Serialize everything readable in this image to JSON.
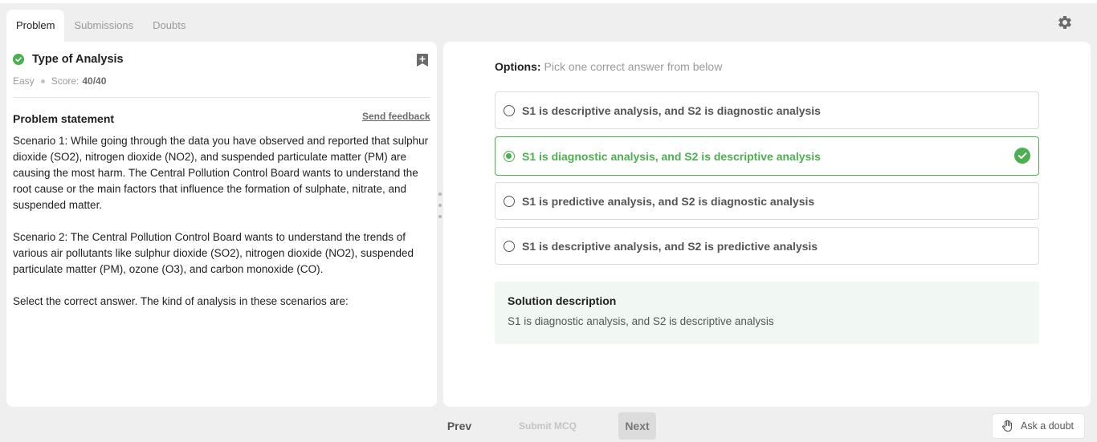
{
  "tabs": [
    {
      "label": "Problem",
      "active": true
    },
    {
      "label": "Submissions",
      "active": false
    },
    {
      "label": "Doubts",
      "active": false
    }
  ],
  "problem": {
    "title": "Type of Analysis",
    "difficulty": "Easy",
    "score_label": "Score:",
    "score_value": "40/40",
    "statement_heading": "Problem statement",
    "feedback_link": "Send feedback",
    "paragraphs": [
      "Scenario 1: While going through the data you have observed and reported that sulphur dioxide (SO2), nitrogen dioxide (NO2), and suspended particulate matter (PM) are causing the most harm. The Central Pollution Control Board wants to understand the root cause or the main factors that influence the formation of sulphate, nitrate, and suspended matter.",
      "Scenario 2: The Central Pollution Control Board wants to understand the trends of various air pollutants like sulphur dioxide (SO2), nitrogen dioxide (NO2), suspended particulate matter (PM), ozone (O3), and carbon monoxide (CO).",
      "Select the correct answer. The kind of analysis in these scenarios are:"
    ]
  },
  "options": {
    "label": "Options:",
    "hint": "Pick one correct answer from below",
    "items": [
      {
        "text": "S1 is descriptive analysis, and S2 is diagnostic analysis",
        "selected": false,
        "correct": false
      },
      {
        "text": "S1 is diagnostic analysis, and S2 is descriptive analysis",
        "selected": true,
        "correct": true
      },
      {
        "text": "S1 is predictive analysis, and S2 is diagnostic analysis",
        "selected": false,
        "correct": false
      },
      {
        "text": "S1 is descriptive analysis, and S2 is predictive analysis",
        "selected": false,
        "correct": false
      }
    ]
  },
  "solution": {
    "title": "Solution description",
    "text": "S1 is diagnostic analysis, and S2 is descriptive analysis"
  },
  "footer": {
    "prev": "Prev",
    "submit": "Submit MCQ",
    "next": "Next",
    "ask_doubt": "Ask a doubt"
  },
  "icons": {
    "settings": "gear-icon",
    "bookmark": "bookmark-plus-icon",
    "solved": "check-circle-icon",
    "correct": "check-circle-icon",
    "ask_doubt": "hand-icon"
  },
  "colors": {
    "accent_green": "#4caf50",
    "solution_bg": "#f1f7f2",
    "page_bg": "#efefef"
  }
}
